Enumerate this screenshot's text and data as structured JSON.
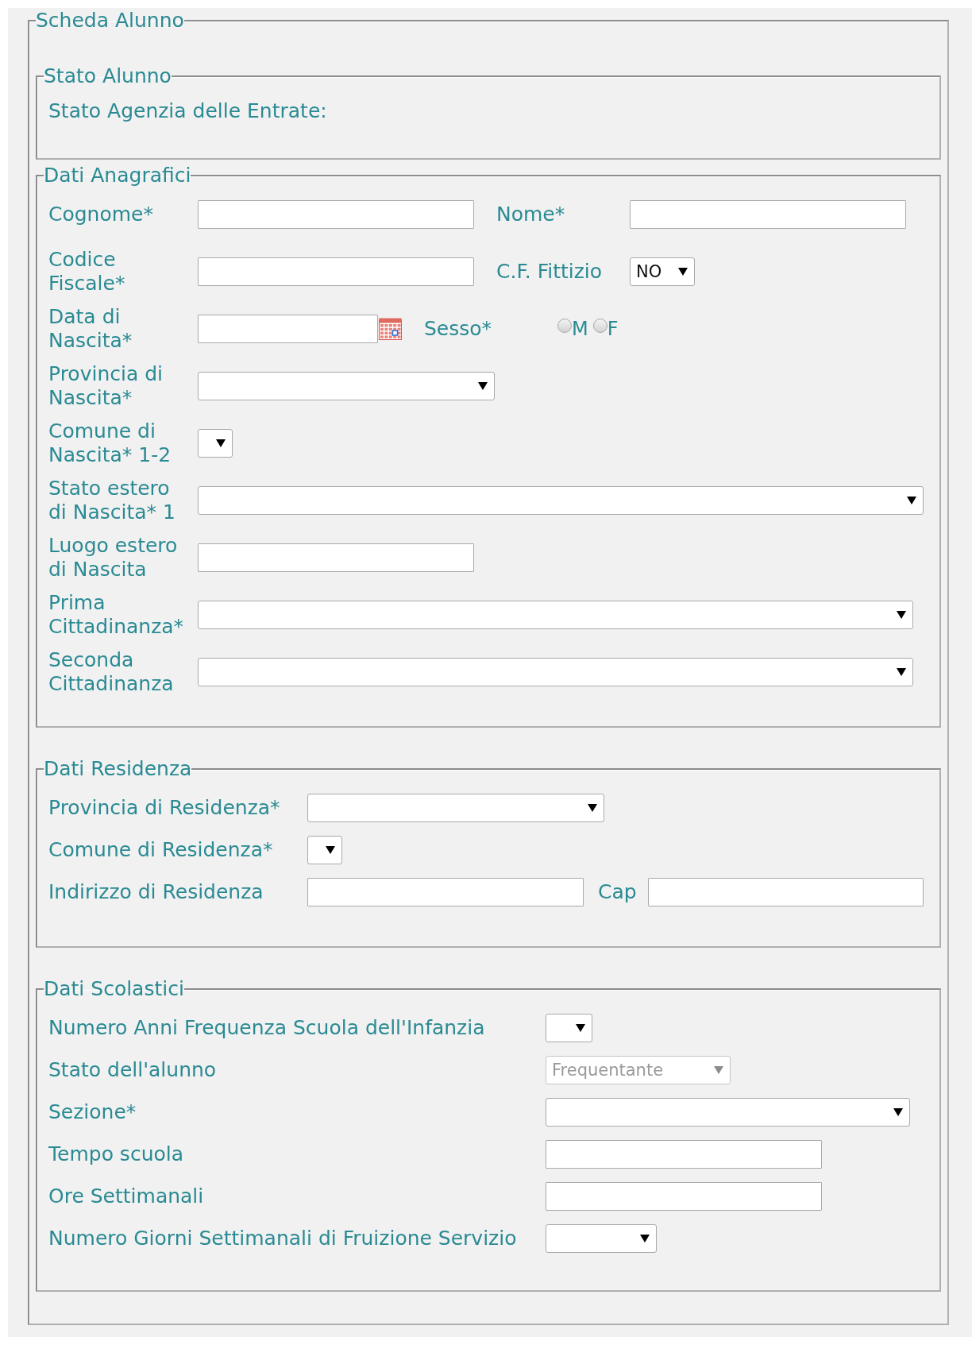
{
  "form": {
    "title": "Scheda Alunno"
  },
  "sections": [
    {
      "title": "Stato Alunno",
      "rows": [
        {
          "fields": [
            {
              "kind": "text",
              "label": "Stato Agenzia delle Entrate:"
            }
          ]
        }
      ]
    },
    {
      "title": "Dati Anagrafici",
      "rows": [
        {
          "fields": [
            {
              "kind": "input",
              "label": "Cognome*"
            },
            {
              "kind": "input",
              "label": "Nome*"
            }
          ]
        },
        {
          "fields": [
            {
              "kind": "input",
              "label": "Codice Fiscale*"
            },
            {
              "kind": "select",
              "label": "C.F. Fittizio",
              "value": "NO",
              "disabled": false
            }
          ]
        },
        {
          "fields": [
            {
              "kind": "date",
              "label": "Data di Nascita*"
            },
            {
              "kind": "radio",
              "label": "Sesso*",
              "options": [
                {
                  "label": "M",
                  "selected": false
                },
                {
                  "label": "F",
                  "selected": false
                }
              ]
            }
          ]
        },
        {
          "fields": [
            {
              "kind": "select",
              "label": "Provincia di Nascita*",
              "disabled": false
            }
          ]
        },
        {
          "fields": [
            {
              "kind": "select",
              "label": "Comune di Nascita* 1-2",
              "disabled": false
            }
          ]
        },
        {
          "fields": [
            {
              "kind": "select",
              "label": "Stato estero di Nascita* 1",
              "disabled": false
            }
          ]
        },
        {
          "fields": [
            {
              "kind": "input",
              "label": "Luogo estero di Nascita"
            }
          ]
        },
        {
          "fields": [
            {
              "kind": "select",
              "label": "Prima Cittadinanza*",
              "disabled": false
            }
          ]
        },
        {
          "fields": [
            {
              "kind": "select",
              "label": "Seconda Cittadinanza",
              "disabled": false
            }
          ]
        }
      ]
    },
    {
      "title": "Dati Residenza",
      "rows": [
        {
          "fields": [
            {
              "kind": "select",
              "label": "Provincia di Residenza*",
              "disabled": false
            }
          ]
        },
        {
          "fields": [
            {
              "kind": "select",
              "label": "Comune di Residenza*",
              "disabled": false
            }
          ]
        },
        {
          "fields": [
            {
              "kind": "input",
              "label": "Indirizzo di Residenza"
            },
            {
              "kind": "input",
              "label": "Cap"
            }
          ]
        }
      ]
    },
    {
      "title": "Dati Scolastici",
      "rows": [
        {
          "fields": [
            {
              "kind": "select",
              "label": "Numero Anni Frequenza Scuola dell'Infanzia",
              "disabled": false
            }
          ]
        },
        {
          "fields": [
            {
              "kind": "select",
              "label": "Stato dell'alunno",
              "value": "Frequentante",
              "disabled": true
            }
          ]
        },
        {
          "fields": [
            {
              "kind": "select",
              "label": "Sezione*",
              "disabled": false
            }
          ]
        },
        {
          "fields": [
            {
              "kind": "input",
              "label": "Tempo scuola"
            }
          ]
        },
        {
          "fields": [
            {
              "kind": "input",
              "label": "Ore Settimanali"
            }
          ]
        },
        {
          "fields": [
            {
              "kind": "select",
              "label": "Numero Giorni Settimanali di Fruizione Servizio",
              "disabled": false
            }
          ]
        }
      ]
    }
  ]
}
